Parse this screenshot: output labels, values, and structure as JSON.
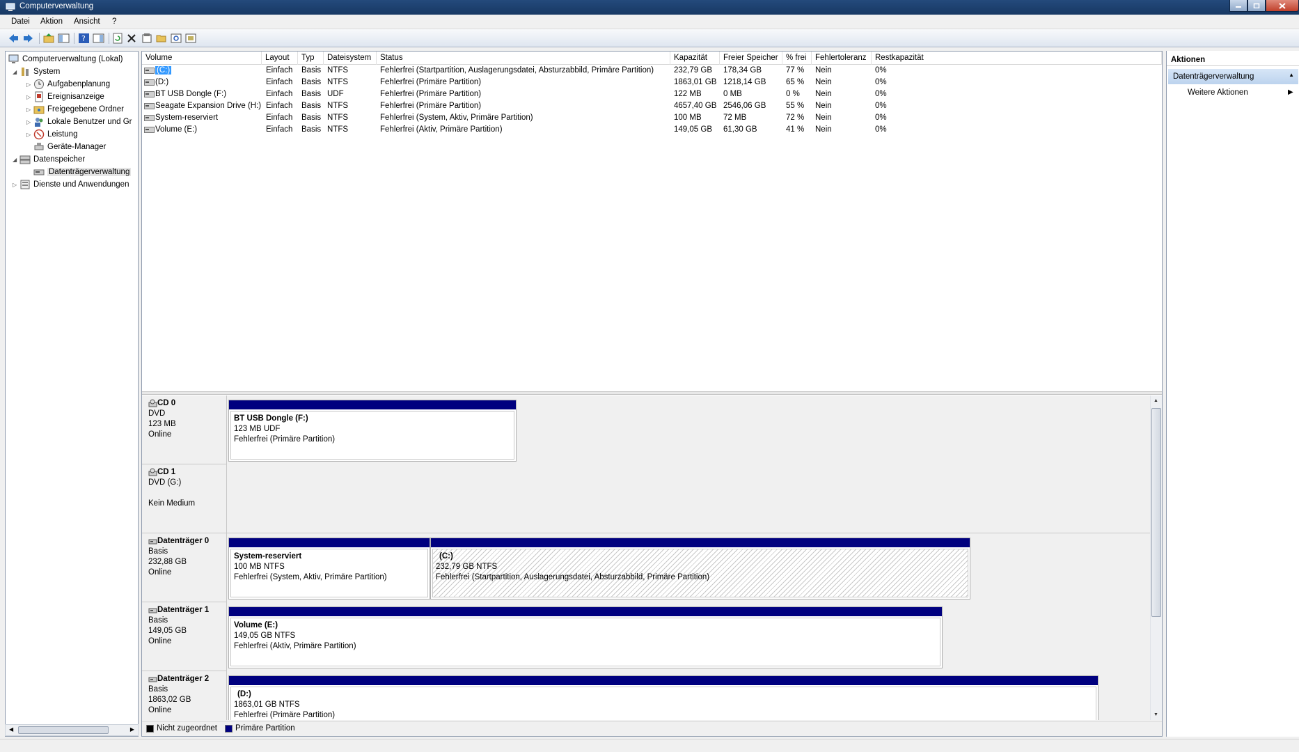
{
  "window": {
    "title": "Computerverwaltung"
  },
  "menu": {
    "items": [
      "Datei",
      "Aktion",
      "Ansicht",
      "?"
    ]
  },
  "toolbar": {
    "buttons": [
      "back-icon",
      "forward-icon",
      "up-icon",
      "show-hide-tree-icon",
      "help-icon",
      "show-hide-action-icon",
      "refresh-icon",
      "delete-icon",
      "properties-icon",
      "open-icon",
      "search-icon",
      "settings-icon"
    ]
  },
  "tree": {
    "root": "Computerverwaltung (Lokal)",
    "system": "System",
    "aufgabenplanung": "Aufgabenplanung",
    "ereignisanzeige": "Ereignisanzeige",
    "freigegebene": "Freigegebene Ordner",
    "benutzer": "Lokale Benutzer und Gr",
    "leistung": "Leistung",
    "geraete": "Geräte-Manager",
    "datenspeicher": "Datenspeicher",
    "datentraeger": "Datenträgerverwaltung",
    "dienste": "Dienste und Anwendungen"
  },
  "columns": [
    "Volume",
    "Layout",
    "Typ",
    "Dateisystem",
    "Status",
    "Kapazität",
    "Freier Speicher",
    "% frei",
    "Fehlertoleranz",
    "Restkapazität"
  ],
  "volumes": [
    {
      "volume": "(C:)",
      "layout": "Einfach",
      "typ": "Basis",
      "fs": "NTFS",
      "status": "Fehlerfrei (Startpartition, Auslagerungsdatei, Absturzabbild, Primäre Partition)",
      "kap": "232,79 GB",
      "frei": "178,34 GB",
      "pct": "77 %",
      "fehler": "Nein",
      "rest": "0%"
    },
    {
      "volume": "(D:)",
      "layout": "Einfach",
      "typ": "Basis",
      "fs": "NTFS",
      "status": "Fehlerfrei (Primäre Partition)",
      "kap": "1863,01 GB",
      "frei": "1218,14 GB",
      "pct": "65 %",
      "fehler": "Nein",
      "rest": "0%"
    },
    {
      "volume": "BT USB Dongle (F:)",
      "layout": "Einfach",
      "typ": "Basis",
      "fs": "UDF",
      "status": "Fehlerfrei (Primäre Partition)",
      "kap": "122 MB",
      "frei": "0 MB",
      "pct": "0 %",
      "fehler": "Nein",
      "rest": "0%"
    },
    {
      "volume": "Seagate Expansion Drive (H:)",
      "layout": "Einfach",
      "typ": "Basis",
      "fs": "NTFS",
      "status": "Fehlerfrei (Primäre Partition)",
      "kap": "4657,40 GB",
      "frei": "2546,06 GB",
      "pct": "55 %",
      "fehler": "Nein",
      "rest": "0%"
    },
    {
      "volume": "System-reserviert",
      "layout": "Einfach",
      "typ": "Basis",
      "fs": "NTFS",
      "status": "Fehlerfrei (System, Aktiv, Primäre Partition)",
      "kap": "100 MB",
      "frei": "72 MB",
      "pct": "72 %",
      "fehler": "Nein",
      "rest": "0%"
    },
    {
      "volume": "Volume (E:)",
      "layout": "Einfach",
      "typ": "Basis",
      "fs": "NTFS",
      "status": "Fehlerfrei (Aktiv, Primäre Partition)",
      "kap": "149,05 GB",
      "frei": "61,30 GB",
      "pct": "41 %",
      "fehler": "Nein",
      "rest": "0%"
    }
  ],
  "disks": {
    "cd0": {
      "name": "CD 0",
      "l1": "DVD",
      "l2": "123 MB",
      "l3": "Online",
      "part": {
        "name": "BT USB Dongle  (F:)",
        "size": "123 MB UDF",
        "status": "Fehlerfrei (Primäre Partition)"
      }
    },
    "cd1": {
      "name": "CD 1",
      "l1": "DVD (G:)",
      "l2": "",
      "l3": "Kein Medium"
    },
    "d0": {
      "name": "Datenträger 0",
      "l1": "Basis",
      "l2": "232,88 GB",
      "l3": "Online",
      "p1": {
        "name": "System-reserviert",
        "size": "100 MB NTFS",
        "status": "Fehlerfrei (System, Aktiv, Primäre Partition)"
      },
      "p2": {
        "name": "(C:)",
        "size": "232,79 GB NTFS",
        "status": "Fehlerfrei (Startpartition, Auslagerungsdatei, Absturzabbild, Primäre Partition)"
      }
    },
    "d1": {
      "name": "Datenträger 1",
      "l1": "Basis",
      "l2": "149,05 GB",
      "l3": "Online",
      "part": {
        "name": "Volume  (E:)",
        "size": "149,05 GB NTFS",
        "status": "Fehlerfrei (Aktiv, Primäre Partition)"
      }
    },
    "d2": {
      "name": "Datenträger 2",
      "l1": "Basis",
      "l2": "1863,02 GB",
      "l3": "Online",
      "part": {
        "name": "(D:)",
        "size": "1863,01 GB NTFS",
        "status": "Fehlerfrei (Primäre Partition)"
      }
    }
  },
  "legend": {
    "unallocated": "Nicht zugeordnet",
    "primary": "Primäre Partition",
    "unallocated_color": "#000000",
    "primary_color": "#00007f"
  },
  "actions": {
    "header": "Aktionen",
    "section": "Datenträgerverwaltung",
    "more": "Weitere Aktionen"
  }
}
